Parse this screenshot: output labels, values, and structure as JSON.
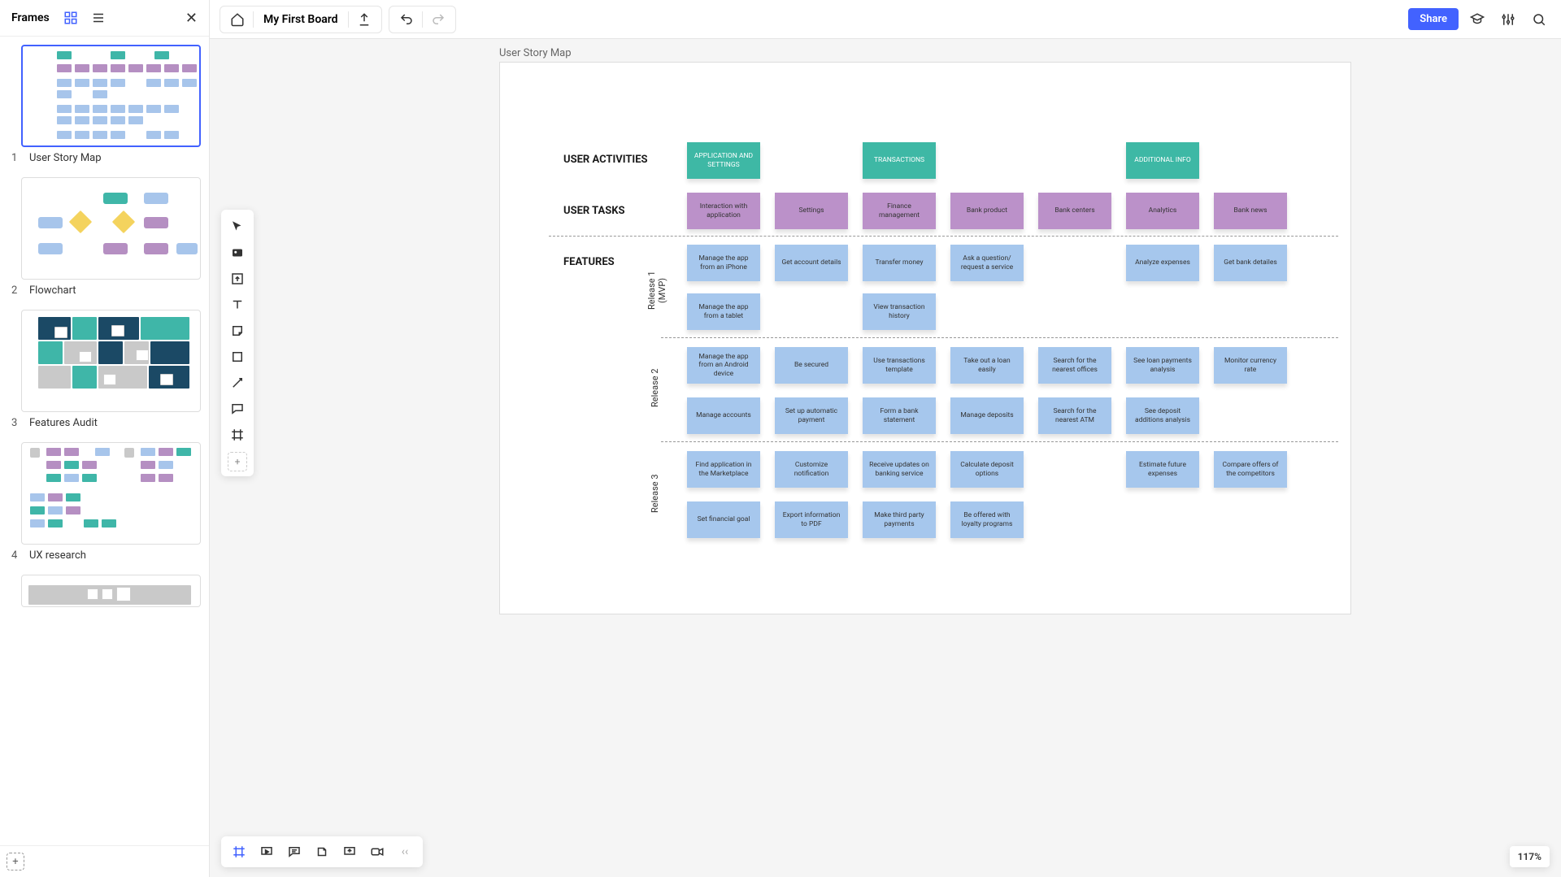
{
  "sidebar": {
    "title": "Frames",
    "frames": [
      {
        "num": "1",
        "label": "User Story Map"
      },
      {
        "num": "2",
        "label": "Flowchart"
      },
      {
        "num": "3",
        "label": "Features Audit"
      },
      {
        "num": "4",
        "label": "UX research"
      }
    ]
  },
  "topbar": {
    "board_name": "My First Board",
    "share": "Share"
  },
  "canvas": {
    "frame_title": "User Story Map",
    "labels": {
      "activities": "USER ACTIVITIES",
      "tasks": "USER TASKS",
      "features": "FEATURES",
      "release1": "Release 1\n(MVP)",
      "release2": "Release 2",
      "release3": "Release 3"
    },
    "activities": [
      "APPLICATION AND SETTINGS",
      "TRANSACTIONS",
      "ADDITIONAL INFO"
    ],
    "tasks": [
      "Interaction with application",
      "Settings",
      "Finance management",
      "Bank product",
      "Bank centers",
      "Analytics",
      "Bank news"
    ],
    "r1a": [
      "Manage the app from an iPhone",
      "Get account details",
      "Transfer money",
      "Ask a question/ request a service",
      "",
      "Analyze expenses",
      "Get bank detailes"
    ],
    "r1b": [
      "Manage the app from a tablet",
      "",
      "View transaction history",
      "",
      "",
      "",
      ""
    ],
    "r2a": [
      "Manage the app from an Android device",
      "Be secured",
      "Use transactions template",
      "Take out a loan easily",
      "Search for the nearest offices",
      "See loan payments analysis",
      "Monitor currency rate"
    ],
    "r2b": [
      "Manage accounts",
      "Set up automatic payment",
      "Form a bank statement",
      "Manage deposits",
      "Search for the nearest ATM",
      "See deposit additions analysis",
      ""
    ],
    "r3a": [
      "Find application in the Marketplace",
      "Customize notification",
      "Receive updates on banking service",
      "Calculate deposit options",
      "",
      "Estimate future expenses",
      "Compare offers of the competitors"
    ],
    "r3b": [
      "Set financial goal",
      "Export information to PDF",
      "Make third party payments",
      "Be offered with loyalty programs",
      "",
      "",
      ""
    ]
  },
  "zoom": "117%"
}
